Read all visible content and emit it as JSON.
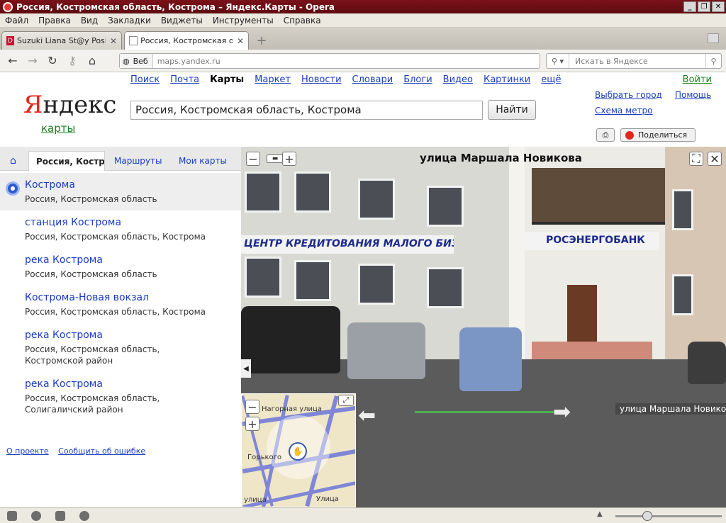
{
  "window": {
    "title": "Россия, Костромская область, Кострома – Яндекс.Карты - Opera"
  },
  "menu": [
    "Файл",
    "Правка",
    "Вид",
    "Закладки",
    "Виджеты",
    "Инструменты",
    "Справка"
  ],
  "tabs": [
    {
      "label": "Suzuki Liana St@y Positive",
      "favicon": "D"
    },
    {
      "label": "Россия, Костромская о..."
    }
  ],
  "address": {
    "security": "Веб",
    "url": "maps.yandex.ru"
  },
  "search": {
    "placeholder": "Искать в Яндексе"
  },
  "yandex": {
    "logo": "Яндекс",
    "logo_first": "Я",
    "logo_rest": "ндекс",
    "subtitle": "карты",
    "services": [
      "Поиск",
      "Почта",
      "Карты",
      "Маркет",
      "Новости",
      "Словари",
      "Блоги",
      "Видео",
      "Картинки",
      "ещё"
    ],
    "login": "Войти",
    "query": "Россия, Костромская область, Кострома",
    "find_button": "Найти",
    "choose_city": "Выбрать город",
    "help": "Помощь",
    "metro": "Схема метро",
    "share": "Поделиться"
  },
  "left_tabs": {
    "active": "Россия, Кострома",
    "routes": "Маршруты",
    "my_maps": "Мои карты"
  },
  "results": [
    {
      "name": "Кострома",
      "address": "Россия, Костромская область"
    },
    {
      "name": "станция Кострома",
      "address": "Россия, Костромская область, Кострома"
    },
    {
      "name": "река Кострома",
      "address": "Россия, Костромская область"
    },
    {
      "name": "Кострома-Новая вокзал",
      "address": "Россия, Костромская область, Кострома"
    },
    {
      "name": "река Кострома",
      "address": "Россия, Костромская область, Костромской район"
    },
    {
      "name": "река Кострома",
      "address": "Россия, Костромская область, Солигаличский район"
    }
  ],
  "footer": {
    "about": "О проекте",
    "report": "Сообщить об ошибке"
  },
  "streetview": {
    "title": "улица Маршала Новикова",
    "street_label": "улица Маршала Новикова",
    "sign_left": "ЦЕНТР КРЕДИТОВАНИЯ МАЛОГО БИЗНЕСА",
    "sign_right": "РОСЭНЕРГОБАНК",
    "mini_streets": [
      "Нагорная улица",
      "Горького",
      "улица",
      "Улица"
    ]
  },
  "colors": {
    "brand_red": "#e5261b",
    "link": "#1a3dc1",
    "green": "#1b7f1b"
  }
}
